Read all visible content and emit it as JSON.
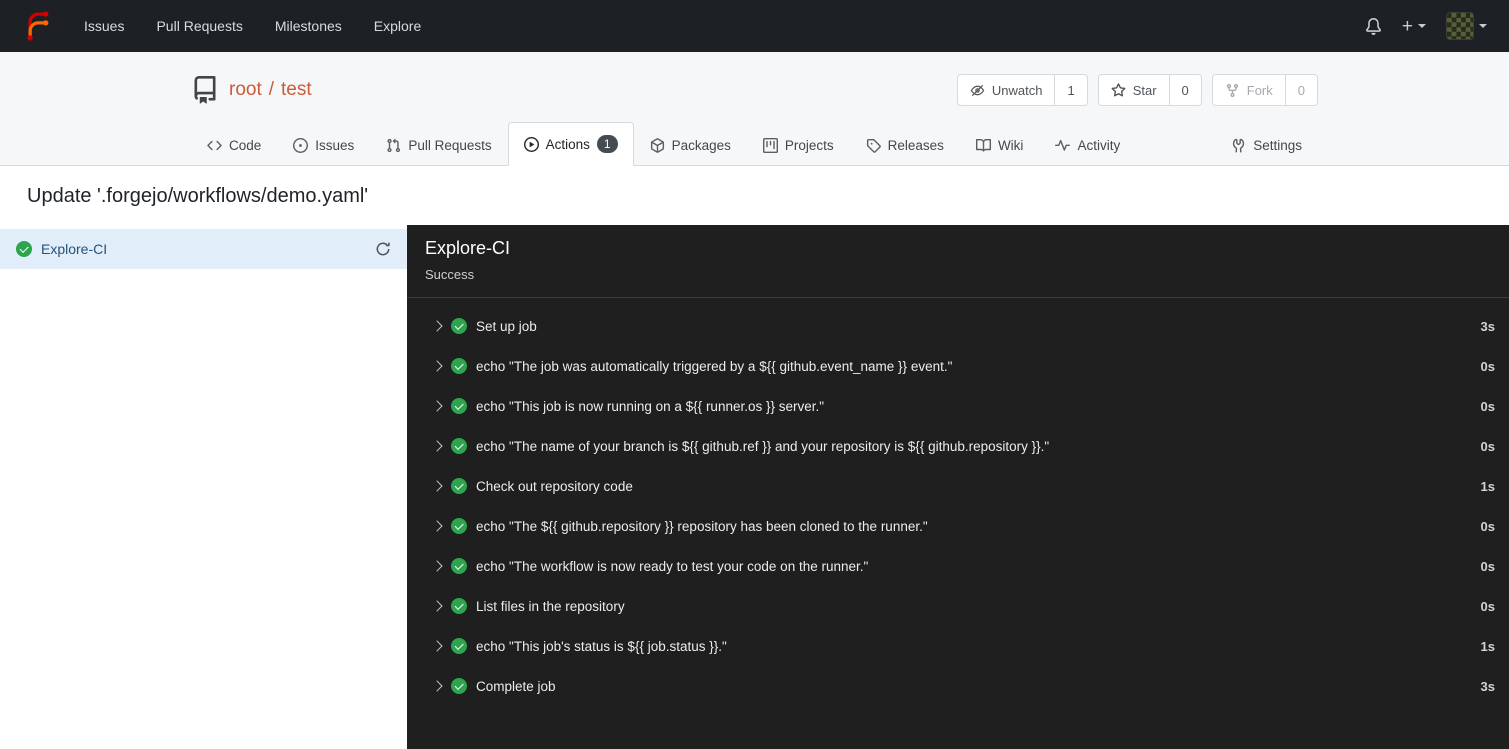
{
  "colors": {
    "primary": "#cb5a3a",
    "success_green": "#2da44e",
    "navbar_bg": "#1d2126",
    "panel_bg": "#1f1f1f",
    "selected_job_bg": "#e1eef9"
  },
  "icons": {
    "forgejo-logo": "orange branching F mark",
    "bell-icon": "notification bell outline",
    "plus-icon": "+",
    "chevron-down-icon": "▾",
    "repo-icon": "book repository glyph",
    "eye-slash-icon": "crossed-out eye",
    "star-icon": "star outline",
    "fork-icon": "git fork",
    "code-icon": "</>",
    "issue-icon": "circle with dot",
    "pull-request-icon": "git pull request",
    "play-circle-icon": "play in circle",
    "package-icon": "package box",
    "project-board-icon": "project board columns",
    "tag-icon": "release tag",
    "book-icon": "open book",
    "pulse-icon": "activity pulse line",
    "tools-icon": "settings tools",
    "sync-icon": "circular refresh arrow",
    "chevron-right-icon": "›",
    "check-circle-icon": "green circle with white check"
  },
  "navbar": {
    "plus_label": "+",
    "items": [
      {
        "label": "Issues"
      },
      {
        "label": "Pull Requests"
      },
      {
        "label": "Milestones"
      },
      {
        "label": "Explore"
      }
    ]
  },
  "repo": {
    "owner": "root",
    "separator": "/",
    "name": "test",
    "buttons": [
      {
        "label": "Unwatch",
        "count": "1"
      },
      {
        "label": "Star",
        "count": "0"
      },
      {
        "label": "Fork",
        "count": "0"
      }
    ],
    "tabs": [
      {
        "label": "Code"
      },
      {
        "label": "Issues"
      },
      {
        "label": "Pull Requests"
      },
      {
        "label": "Actions",
        "badge": "1",
        "active": true
      },
      {
        "label": "Packages"
      },
      {
        "label": "Projects"
      },
      {
        "label": "Releases"
      },
      {
        "label": "Wiki"
      },
      {
        "label": "Activity"
      }
    ],
    "settings_tab": {
      "label": "Settings"
    }
  },
  "run": {
    "title": "Update '.forgejo/workflows/demo.yaml'",
    "jobs": [
      {
        "name": "Explore-CI",
        "status": "success"
      }
    ],
    "panel": {
      "title": "Explore-CI",
      "status": "Success",
      "steps": [
        {
          "name": "Set up job",
          "duration": "3s"
        },
        {
          "name": "echo \"The job was automatically triggered by a ${{ github.event_name }} event.\"",
          "duration": "0s"
        },
        {
          "name": "echo \"This job is now running on a ${{ runner.os }} server.\"",
          "duration": "0s"
        },
        {
          "name": "echo \"The name of your branch is ${{ github.ref }} and your repository is ${{ github.repository }}.\"",
          "duration": "0s"
        },
        {
          "name": "Check out repository code",
          "duration": "1s"
        },
        {
          "name": "echo \"The ${{ github.repository }} repository has been cloned to the runner.\"",
          "duration": "0s"
        },
        {
          "name": "echo \"The workflow is now ready to test your code on the runner.\"",
          "duration": "0s"
        },
        {
          "name": "List files in the repository",
          "duration": "0s"
        },
        {
          "name": "echo \"This job's status is ${{ job.status }}.\"",
          "duration": "1s"
        },
        {
          "name": "Complete job",
          "duration": "3s"
        }
      ]
    }
  }
}
